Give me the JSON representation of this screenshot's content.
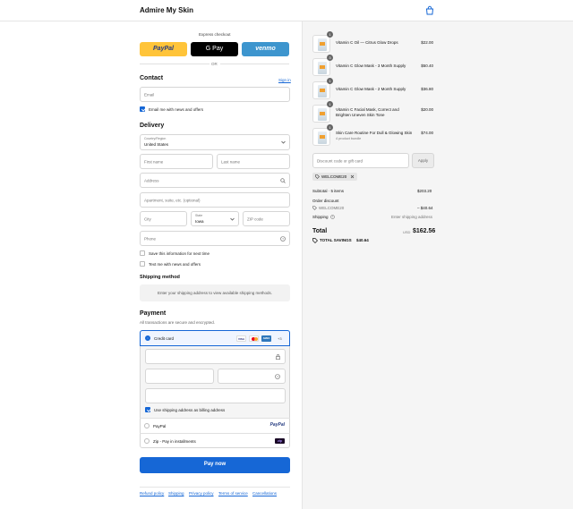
{
  "header": {
    "store_name": "Admire My Skin"
  },
  "express": {
    "title": "Express checkout",
    "paypal": "PayPal",
    "gpay": "G Pay",
    "venmo": "venmo",
    "or": "OR"
  },
  "contact": {
    "title": "Contact",
    "signin": "Sign in",
    "email_placeholder": "Email",
    "news_label": "Email me with news and offers",
    "news_checked": true
  },
  "delivery": {
    "title": "Delivery",
    "country_label": "Country/Region",
    "country_value": "United States",
    "first_name": "First name",
    "last_name": "Last name",
    "address": "Address",
    "apartment": "Apartment, suite, etc. (optional)",
    "city": "City",
    "state_label": "State",
    "state_value": "Iowa",
    "zip": "ZIP code",
    "phone": "Phone",
    "save_info": "Save this information for next time",
    "text_news": "Text me with news and offers"
  },
  "shipping_method": {
    "title": "Shipping method",
    "message": "Enter your shipping address to view available shipping methods."
  },
  "payment": {
    "title": "Payment",
    "subtitle": "All transactions are secure and encrypted.",
    "credit_card": "Credit card",
    "card_more": "+3",
    "card_brands": [
      "VISA",
      "MC",
      "AMEX"
    ],
    "billing_same": "Use shipping address as billing address",
    "paypal": "PayPal",
    "paypal_logo": "PayPal",
    "zip": "Zip - Pay in installments",
    "zip_logo": "zip"
  },
  "pay_now": "Pay now",
  "footer_links": [
    "Refund policy",
    "Shipping",
    "Privacy policy",
    "Terms of service",
    "Cancellations"
  ],
  "order": {
    "items": [
      {
        "qty": "1",
        "name": "Vitamin C Oil — Citrus Glow Drops",
        "sub": "",
        "price": "$22.00"
      },
      {
        "qty": "3",
        "name": "Vitamin C Glow Mask - 3 Month Supply",
        "sub": "",
        "price": "$50.40"
      },
      {
        "qty": "1",
        "name": "Vitamin C Glow Mask - 2 Month Supply",
        "sub": "",
        "price": "$36.80"
      },
      {
        "qty": "1",
        "name": "Vitamin C Facial Mask, Correct and Brighten Uneven Skin Tone",
        "sub": "",
        "price": "$20.00"
      },
      {
        "qty": "1",
        "name": "Skin Care Routine For Dull & Glowing Skin",
        "sub": "4 product bundle",
        "price": "$74.00"
      }
    ],
    "discount_placeholder": "Discount code or gift card",
    "apply": "Apply",
    "code_tag": "WELCOME20",
    "subtotal_label": "Subtotal · 5 items",
    "subtotal_value": "$203.20",
    "order_discount_label": "Order discount",
    "discount_code": "WELCOME20",
    "discount_value": "– $40.64",
    "shipping_label": "Shipping",
    "shipping_value": "Enter shipping address",
    "total_label": "Total",
    "currency": "USD",
    "total_value": "$162.56",
    "savings_label": "TOTAL SAVINGS",
    "savings_value": "$40.64"
  },
  "colors": {
    "accent": "#1667d6",
    "paypal_yellow": "#ffc439",
    "venmo_blue": "#3d95ce",
    "gpay_black": "#000000"
  }
}
